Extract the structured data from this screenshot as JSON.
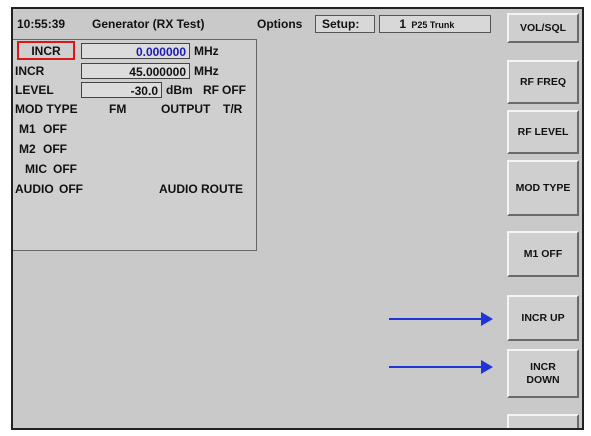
{
  "topbar": {
    "time": "10:55:39",
    "title": "Generator (RX Test)",
    "options": "Options",
    "setup": "Setup:",
    "trunk_number": "1",
    "trunk_mode": "P25 Trunk"
  },
  "panel": {
    "incr_selected": "INCR",
    "incr_selected_value": "0.000000",
    "incr_selected_unit": "MHz",
    "incr_label": "INCR",
    "incr_value": "45.000000",
    "incr_unit": "MHz",
    "level_label": "LEVEL",
    "level_value": "-30.0",
    "level_unit": "dBm",
    "rf_label": "RF",
    "rf_value": "OFF",
    "mod_type_label": "MOD TYPE",
    "mod_type_value": "FM",
    "output_label": "OUTPUT",
    "output_value": "T/R",
    "m1_label": "M1",
    "m1_value": "OFF",
    "m2_label": "M2",
    "m2_value": "OFF",
    "mic_label": "MIC",
    "mic_value": "OFF",
    "audio_label": "AUDIO",
    "audio_value": "OFF",
    "audio_route": "AUDIO ROUTE"
  },
  "softkeys": {
    "vol_sql": "VOL/SQL",
    "rf_freq": "RF FREQ",
    "rf_level": "RF LEVEL",
    "mod_type": "MOD TYPE",
    "m1_off": "M1 OFF",
    "incr_up": "INCR UP",
    "incr_down": "INCR DOWN",
    "blank": ""
  },
  "colors": {
    "annotation_arrow": "#1f35d6",
    "selection_border": "#d81818",
    "value_text": "#1a1ab8",
    "screen_background": "#c9c9c9"
  }
}
